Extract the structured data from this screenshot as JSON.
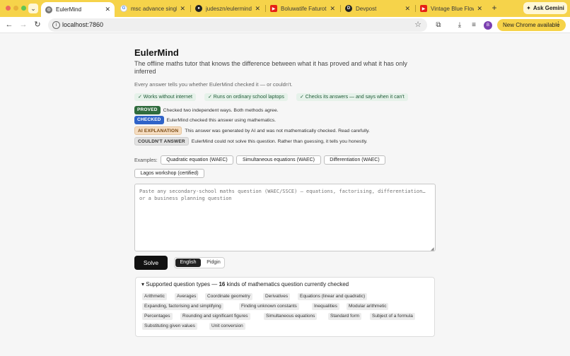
{
  "browser": {
    "tabs": [
      {
        "title": "EulerMind",
        "active": true,
        "favicon": "globe-icon",
        "color": "#555555"
      },
      {
        "title": "msc advance single...",
        "active": false,
        "favicon": "google-icon",
        "color": "#4285f4"
      },
      {
        "title": "judeszn/eulermind-...",
        "active": false,
        "favicon": "github-icon",
        "color": "#222222"
      },
      {
        "title": "Boluwatife Faturoti ·",
        "active": false,
        "favicon": "youtube-icon",
        "color": "#e62117"
      },
      {
        "title": "Devpost",
        "active": false,
        "favicon": "devpost-icon",
        "color": "#222222"
      },
      {
        "title": "Vintage Blue Flowers",
        "active": false,
        "favicon": "youtube-icon",
        "color": "#e62117"
      }
    ],
    "ask_gemini": "Ask Gemini",
    "url": "localhost:7860",
    "profile_initial": "B",
    "update_button": "New Chrome available"
  },
  "app": {
    "title": "EulerMind",
    "subtitle": "The offline maths tutor that knows the difference between what it has proved and what it has only inferred",
    "tagline": "Every answer tells you whether EulerMind checked it — or couldn't.",
    "features": [
      "✓ Works without internet",
      "✓ Runs on ordinary school laptops",
      "✓ Checks its answers — and says when it can't"
    ],
    "legend": [
      {
        "badge": "PROVED",
        "text": "Checked two independent ways. Both methods agree."
      },
      {
        "badge": "CHECKED",
        "text": "EulerMind checked this answer using mathematics."
      },
      {
        "badge": "AI EXPLANATION",
        "text": "This answer was generated by AI and was not mathematically checked. Read carefully."
      },
      {
        "badge": "COULDN'T ANSWER",
        "text": "EulerMind could not solve this question. Rather than guessing, it tells you honestly."
      }
    ],
    "examples_label": "Examples:",
    "examples": [
      "Quadratic equation (WAEC)",
      "Simultaneous equations (WAEC)",
      "Differentiation (WAEC)",
      "Lagos workshop (certified)"
    ],
    "question_placeholder": "Paste any secondary-school maths question (WAEC/SSCE) — equations, factorising, differentiation… or a business planning question",
    "solve_label": "Solve",
    "languages": [
      "English",
      "Pidgin"
    ],
    "selected_language": "English",
    "supported": {
      "prefix": "Supported question types — ",
      "count": "16",
      "suffix": " kinds of mathematics question currently checked",
      "types": [
        "Arithmetic",
        "Averages",
        "Coordinate geometry",
        "Derivatives",
        "Equations (linear and quadratic)",
        "Expanding, factorising and simplifying",
        "Finding unknown constants",
        "Inequalities",
        "Modular arithmetic",
        "Percentages",
        "Rounding and significant figures",
        "Simultaneous equations",
        "Standard form",
        "Subject of a formula",
        "Substituting given values",
        "Unit conversion"
      ]
    }
  }
}
